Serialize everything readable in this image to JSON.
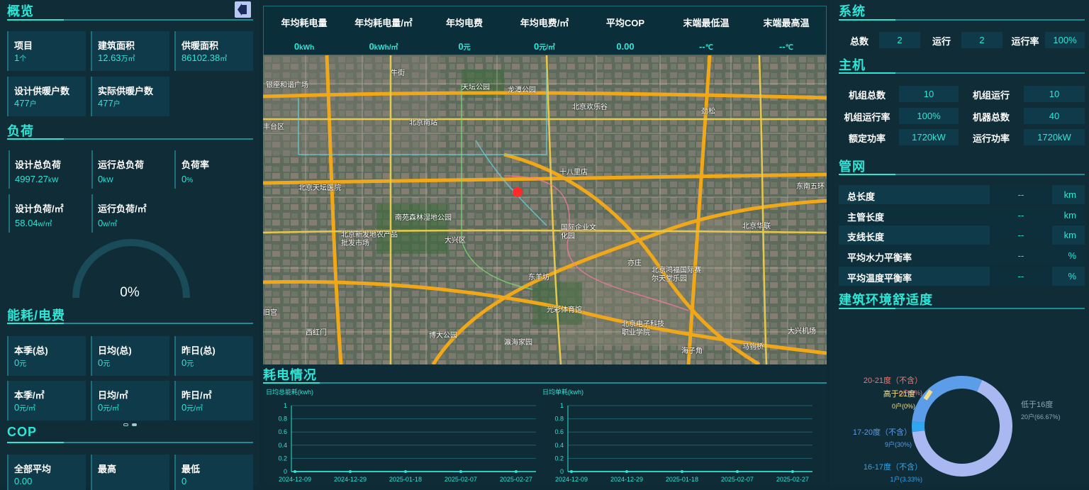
{
  "overview": {
    "title": "概览",
    "cards": [
      {
        "label": "项目",
        "value": "1",
        "unit": "个"
      },
      {
        "label": "建筑面积",
        "value": "12.63",
        "unit": "万㎡"
      },
      {
        "label": "供暖面积",
        "value": "86102.38",
        "unit": "㎡"
      },
      {
        "label": "设计供暖户数",
        "value": "477",
        "unit": "户"
      },
      {
        "label": "实际供暖户数",
        "value": "477",
        "unit": "户"
      }
    ]
  },
  "load": {
    "title": "负荷",
    "items": [
      {
        "label": "设计总负荷",
        "value": "4997.27",
        "unit": "kW"
      },
      {
        "label": "运行总负荷",
        "value": "0",
        "unit": "kW"
      },
      {
        "label": "负荷率",
        "value": "0",
        "unit": "%"
      },
      {
        "label": "设计负荷/㎡",
        "value": "58.04",
        "unit": "w/㎡"
      },
      {
        "label": "运行负荷/㎡",
        "value": "0",
        "unit": "w/㎡"
      }
    ],
    "gauge_value": "0%",
    "gauge_fraction": 0
  },
  "energy": {
    "title": "能耗/电费",
    "cards": [
      {
        "label": "本季(总)",
        "value": "0",
        "unit": "元"
      },
      {
        "label": "日均(总)",
        "value": "0",
        "unit": "元"
      },
      {
        "label": "昨日(总)",
        "value": "0",
        "unit": "元"
      },
      {
        "label": "本季/㎡",
        "value": "0",
        "unit": "元/㎡"
      },
      {
        "label": "日均/㎡",
        "value": "0",
        "unit": "元/㎡"
      },
      {
        "label": "昨日/㎡",
        "value": "0",
        "unit": "元/㎡"
      }
    ]
  },
  "cop": {
    "title": "COP",
    "cards": [
      {
        "label": "全部平均",
        "value": "0.00"
      },
      {
        "label": "最高",
        "value": ""
      },
      {
        "label": "最低",
        "value": "0"
      }
    ]
  },
  "topstats": [
    {
      "label": "年均耗电量",
      "value": "0",
      "unit": "kWh"
    },
    {
      "label": "年均耗电量/㎡",
      "value": "0",
      "unit": "kWh/㎡"
    },
    {
      "label": "年均电费",
      "value": "0",
      "unit": "元"
    },
    {
      "label": "年均电费/㎡",
      "value": "0",
      "unit": "元/㎡"
    },
    {
      "label": "平均COP",
      "value": "0.00",
      "unit": ""
    },
    {
      "label": "末端最低温",
      "value": "--",
      "unit": "℃"
    },
    {
      "label": "末端最高温",
      "value": "--",
      "unit": "℃"
    }
  ],
  "map": {
    "labels": [
      "银座和谐广场",
      "牛街",
      "天坛公园",
      "龙潭公园",
      "北京南站",
      "北京欢乐谷",
      "劲松",
      "丰台区",
      "北京天坛医院",
      "十八里店",
      "北京新发地农产品批发市场",
      "南苑森林湿地公园",
      "国际企业文化园",
      "大兴区",
      "东南五环",
      "北京华联",
      "东羊坊",
      "亦庄",
      "北京鸿福国际赛尔天堂乐园",
      "旧宫",
      "光彩体育馆",
      "北京电子科技职业学院",
      "西红门",
      "博大公园",
      "马驹桥",
      "瀛海家园",
      "海子角",
      "大兴机场"
    ]
  },
  "power_chart": {
    "title": "耗电情况",
    "charts": [
      {
        "ylabel": "日均总能耗(kwh)",
        "type": "line",
        "x": [
          "2024-12-09",
          "2024-12-29",
          "2025-01-18",
          "2025-02-07",
          "2025-02-27"
        ],
        "values": [
          0,
          0,
          0,
          0,
          0
        ],
        "yticks": [
          "1",
          "0.8",
          "0.6",
          "0.4",
          "0.2",
          "0"
        ],
        "ylim": [
          0,
          1
        ]
      },
      {
        "ylabel": "日均单耗(kwh)",
        "type": "line",
        "x": [
          "2024-12-09",
          "2024-12-29",
          "2025-01-18",
          "2025-02-07",
          "2025-02-27"
        ],
        "values": [
          0,
          0,
          0,
          0,
          0
        ],
        "yticks": [
          "1",
          "0.8",
          "0.6",
          "0.4",
          "0.2",
          "0"
        ],
        "ylim": [
          0,
          1
        ]
      }
    ]
  },
  "system": {
    "title": "系统",
    "labels": [
      "总数",
      "运行",
      "运行率"
    ],
    "values": [
      "2",
      "2",
      "100%"
    ]
  },
  "host": {
    "title": "主机",
    "rows": [
      [
        "机组总数",
        "10",
        "机组运行",
        "10"
      ],
      [
        "机组运行率",
        "100%",
        "机器总数",
        "40"
      ],
      [
        "额定功率",
        "1720kW",
        "运行功率",
        "1720kW"
      ]
    ]
  },
  "pipe": {
    "title": "管网",
    "rows": [
      {
        "name": "总长度",
        "value": "--",
        "unit": "km"
      },
      {
        "name": "主管长度",
        "value": "--",
        "unit": "km"
      },
      {
        "name": "支线长度",
        "value": "--",
        "unit": "km"
      },
      {
        "name": "平均水力平衡率",
        "value": "--",
        "unit": "%"
      },
      {
        "name": "平均温度平衡率",
        "value": "--",
        "unit": "%"
      }
    ]
  },
  "comfort": {
    "title": "建筑环境舒适度",
    "chart_data": {
      "type": "pie",
      "slices": [
        {
          "name": "低于16度",
          "value": 20,
          "label": "20户(66.67%)",
          "color": "#a9b8f0"
        },
        {
          "name": "16-17度（不含）",
          "value": 1,
          "label": "1户(3.33%)",
          "color": "#2fa6f0"
        },
        {
          "name": "17-20度（不含）",
          "value": 9,
          "label": "9户(30%)",
          "color": "#5b9de8"
        },
        {
          "name": "20-21度（不含）",
          "value": 0,
          "label": "0户(0%)",
          "color": "#f07878"
        },
        {
          "name": "高于21度",
          "value": 0,
          "label": "0户(0%)",
          "color": "#f5e08a"
        }
      ]
    }
  },
  "colors": {
    "accent": "#2ee6d6",
    "panel": "#0f3a4a",
    "bg": "#0d2a35"
  }
}
